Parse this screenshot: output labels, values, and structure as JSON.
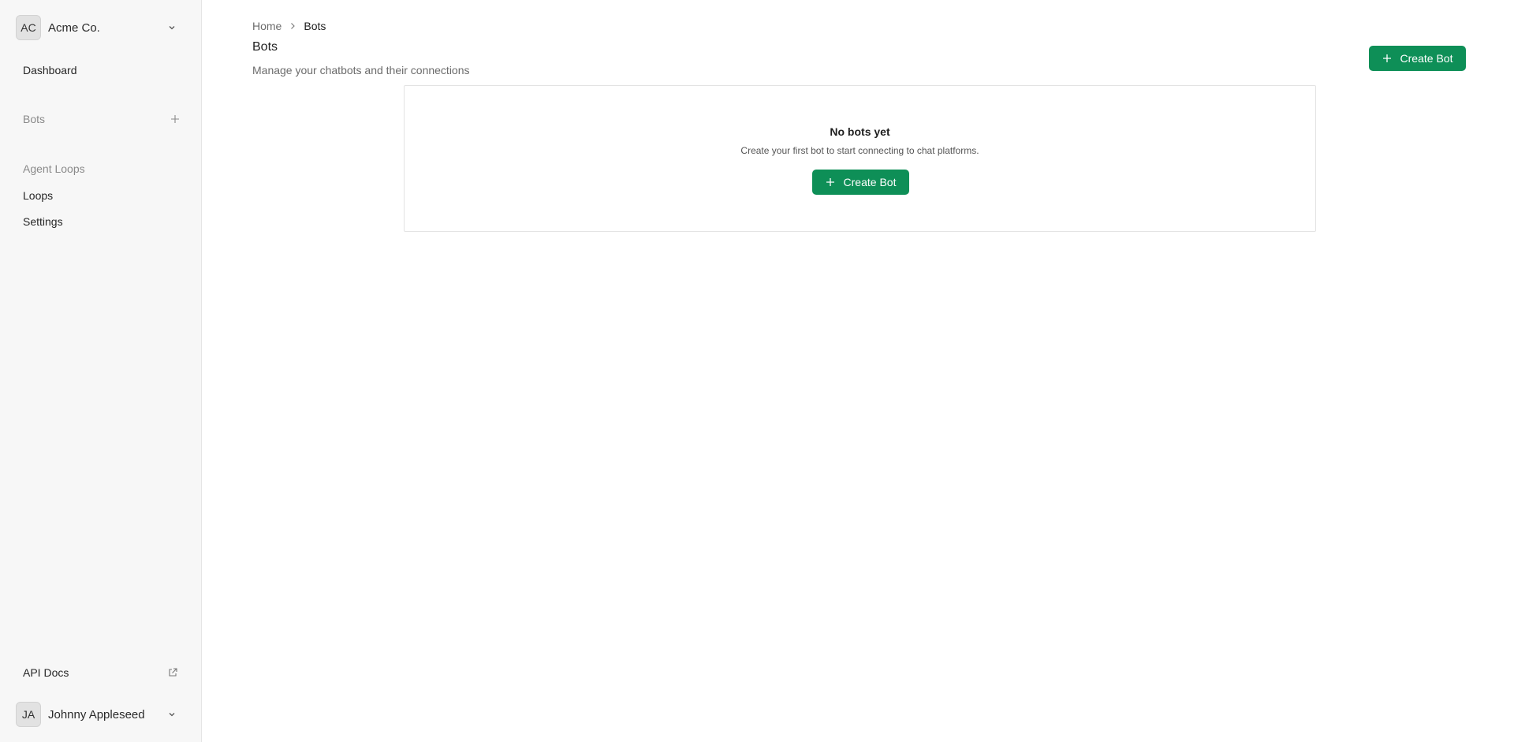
{
  "sidebar": {
    "org": {
      "initials": "AC",
      "name": "Acme Co."
    },
    "nav": {
      "dashboard": "Dashboard",
      "bots_section": "Bots",
      "agent_loops_section": "Agent Loops",
      "loops": "Loops",
      "settings": "Settings"
    },
    "api_docs": "API Docs",
    "user": {
      "initials": "JA",
      "name": "Johnny Appleseed"
    }
  },
  "breadcrumb": {
    "home": "Home",
    "current": "Bots"
  },
  "page": {
    "title": "Bots",
    "subtitle": "Manage your chatbots and their connections",
    "create_button": "Create Bot"
  },
  "empty_state": {
    "title": "No bots yet",
    "description": "Create your first bot to start connecting to chat platforms.",
    "button": "Create Bot"
  },
  "colors": {
    "primary": "#0e8f57",
    "sidebar_bg": "#f7f7f7"
  },
  "icons": [
    "chevron-down-icon",
    "plus-icon",
    "external-link-icon",
    "chevron-right-icon"
  ]
}
